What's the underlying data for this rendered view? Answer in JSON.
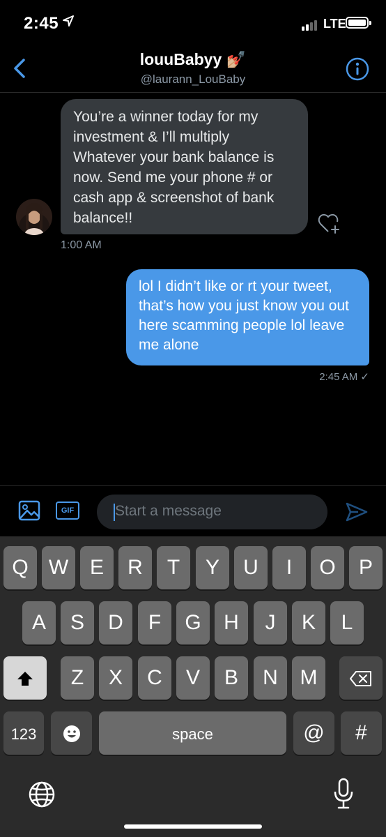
{
  "status": {
    "time": "2:45",
    "network": "LTE"
  },
  "header": {
    "name": "louuBabyy 💅🏼",
    "handle": "@laurann_LouBaby"
  },
  "messages": {
    "incoming": {
      "text": "You’re a winner today for my investment & I’ll multiply Whatever your bank balance is now. Send me your phone # or cash app & screenshot of bank balance!!",
      "timestamp": "1:00 AM"
    },
    "outgoing": {
      "text": "lol I didn’t like or rt your tweet, that’s how you just know you out here scamming people lol leave me alone",
      "timestamp": "2:45 AM ✓"
    }
  },
  "composer": {
    "placeholder": "Start a message",
    "gif_label": "GIF"
  },
  "keyboard": {
    "row1": [
      "Q",
      "W",
      "E",
      "R",
      "T",
      "Y",
      "U",
      "I",
      "O",
      "P"
    ],
    "row2": [
      "A",
      "S",
      "D",
      "F",
      "G",
      "H",
      "J",
      "K",
      "L"
    ],
    "row3": [
      "Z",
      "X",
      "C",
      "V",
      "B",
      "N",
      "M"
    ],
    "num_label": "123",
    "space_label": "space",
    "at_label": "@",
    "hash_label": "#"
  },
  "colors": {
    "accent": "#4a98e8",
    "incoming_bubble": "#363a3e",
    "background": "#000000"
  },
  "icons": [
    "location-arrow-icon",
    "back-chevron-icon",
    "info-icon",
    "like-add-icon",
    "image-icon",
    "send-icon",
    "shift-icon",
    "backspace-icon",
    "emoji-icon",
    "globe-icon",
    "microphone-icon"
  ]
}
